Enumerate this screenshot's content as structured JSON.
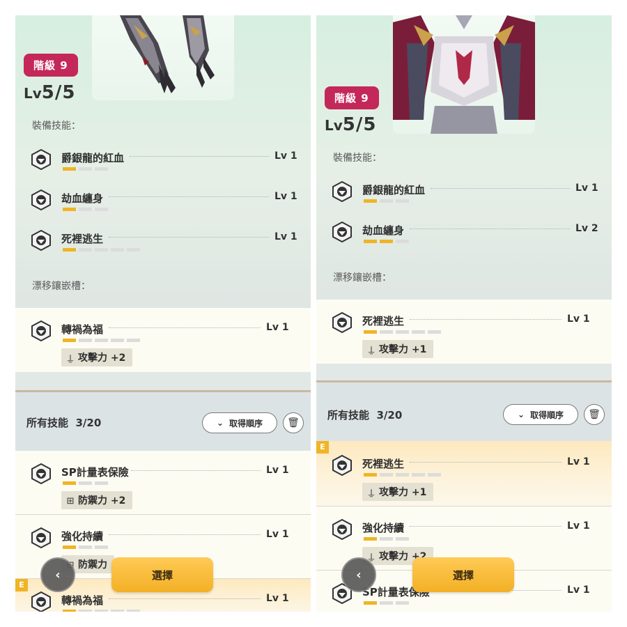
{
  "colors": {
    "rank_badge": "#c4285a",
    "accent_bar": "#f0b425",
    "select_button": "#f6b531"
  },
  "icons": {
    "skill": "skill-emblem-icon",
    "attack": "sword-icon",
    "defense": "shield-icon",
    "sort": "chevron-down-icon",
    "delete": "trash-icon",
    "back": "chevron-left-icon"
  },
  "left": {
    "rank_badge": "階級 9",
    "lv_prefix": "Lv",
    "lv_value": "5/5",
    "equip_skills_label": "裝備技能：",
    "equip_skills": [
      {
        "name": "爵銀龍的紅血",
        "level": "Lv 1",
        "filled": 1,
        "total": 3
      },
      {
        "name": "劫血纏身",
        "level": "Lv 1",
        "filled": 1,
        "total": 3
      },
      {
        "name": "死裡逃生",
        "level": "Lv 1",
        "filled": 1,
        "total": 5
      }
    ],
    "drift_label": "漂移鑲嵌槽：",
    "drift_skill": {
      "name": "轉禍為福",
      "level": "Lv 1",
      "filled": 1,
      "total": 5,
      "bonus": "攻擊力 +2"
    },
    "all_skills_title": "所有技能",
    "all_skills_count": "3/20",
    "sort_label": "取得順序",
    "list": [
      {
        "name": "SP計量表保險",
        "level": "Lv 1",
        "filled": 1,
        "total": 3,
        "bonus": "防禦力 +2"
      },
      {
        "name": "強化持續",
        "level": "Lv 1",
        "filled": 1,
        "total": 3,
        "bonus": "防禦力"
      },
      {
        "name": "轉禍為福",
        "level": "Lv 1",
        "filled": 1,
        "total": 5,
        "equipped_mark": "E"
      }
    ],
    "select_label": "選擇"
  },
  "right": {
    "rank_badge": "階級 9",
    "lv_prefix": "Lv",
    "lv_value": "5/5",
    "equip_skills_label": "裝備技能：",
    "equip_skills": [
      {
        "name": "爵銀龍的紅血",
        "level": "Lv 1",
        "filled": 1,
        "total": 3
      },
      {
        "name": "劫血纏身",
        "level": "Lv 2",
        "filled": 2,
        "total": 3
      }
    ],
    "drift_label": "漂移鑲嵌槽：",
    "drift_skill": {
      "name": "死裡逃生",
      "level": "Lv 1",
      "filled": 1,
      "total": 5,
      "bonus": "攻擊力 +1"
    },
    "all_skills_title": "所有技能",
    "all_skills_count": "3/20",
    "sort_label": "取得順序",
    "list": [
      {
        "name": "死裡逃生",
        "level": "Lv 1",
        "filled": 1,
        "total": 5,
        "bonus": "攻擊力 +1",
        "equipped_mark": "E"
      },
      {
        "name": "強化持續",
        "level": "Lv 1",
        "filled": 1,
        "total": 3,
        "bonus": "攻擊力 +2"
      },
      {
        "name": "SP計量表保險",
        "level": "Lv 1"
      }
    ],
    "select_label": "選擇"
  }
}
